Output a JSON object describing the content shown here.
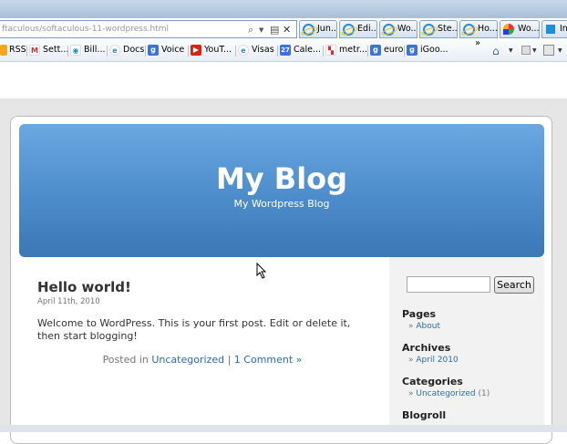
{
  "browser": {
    "address_text": "ftaculous/softaculous-11-wordpress.html",
    "tabs": [
      "Jun...",
      "Edi...",
      "Wo...",
      "Ste...",
      "Ho...",
      "Wo...",
      "Int"
    ],
    "bookmarks": [
      "RSS",
      "Sett...",
      "Bill...",
      "Docs",
      "Voice",
      "YouT...",
      "Visas",
      "Cale...",
      "metr...",
      "euro",
      "iGoo..."
    ],
    "overflow": "»"
  },
  "header": {
    "title": "My Blog",
    "description": "My Wordpress Blog"
  },
  "post": {
    "title": "Hello world!",
    "date": "April 11th, 2010",
    "body": "Welcome to WordPress. This is your first post. Edit or delete it, then start blogging!",
    "posted_in": "Posted in",
    "category": "Uncategorized",
    "separator": "|",
    "comments": "1 Comment »"
  },
  "sidebar": {
    "search_button": "Search",
    "pages_title": "Pages",
    "pages": [
      "About"
    ],
    "archives_title": "Archives",
    "archives": [
      "April 2010"
    ],
    "categories_title": "Categories",
    "categories": [
      {
        "name": "Uncategorized",
        "count": "(1)"
      }
    ],
    "blogroll_title": "Blogroll"
  },
  "colors": {
    "header_top": "#6aa8e2",
    "header_bottom": "#3c77b6",
    "link": "#2a6bb3",
    "sidebar_bg": "#f2f2f2"
  }
}
